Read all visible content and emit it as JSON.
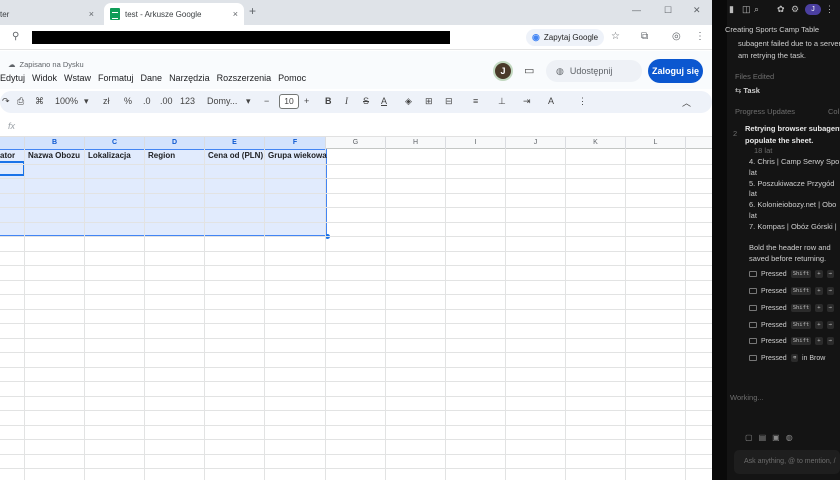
{
  "browser": {
    "tabs": [
      {
        "title": "ter",
        "close": "×"
      },
      {
        "title": "test - Arkusze Google",
        "close": "×"
      }
    ],
    "new_tab": "+",
    "window_controls": [
      "—",
      "☐",
      "✕"
    ],
    "ask_google": "Zapytaj Google"
  },
  "sheets": {
    "save_status": "Zapisano na Dysku",
    "menu": [
      "Edytuj",
      "Widok",
      "Wstaw",
      "Formatuj",
      "Dane",
      "Narzędzia",
      "Rozszerzenia",
      "Pomoc"
    ],
    "avatar_letter": "J",
    "share_label": "Udostępnij",
    "login_label": "Zaloguj się",
    "toolbar": {
      "zoom": "100%",
      "percent": "%",
      "decrease_decimals": ".0",
      "increase_decimals": ".00",
      "number_format": "123",
      "font": "Domy...",
      "font_size": "10",
      "bold": "B",
      "italic": "I",
      "strikethrough": "S",
      "text_color": "A",
      "minus": "−",
      "plus": "+"
    },
    "fx": "fx",
    "columns": [
      {
        "letter": "",
        "header": "ator"
      },
      {
        "letter": "B",
        "header": "Nazwa Obozu"
      },
      {
        "letter": "C",
        "header": "Lokalizacja"
      },
      {
        "letter": "D",
        "header": "Region"
      },
      {
        "letter": "E",
        "header": "Cena od (PLN)"
      },
      {
        "letter": "F",
        "header": "Grupa wiekowa"
      },
      {
        "letter": "G",
        "header": ""
      },
      {
        "letter": "H",
        "header": ""
      },
      {
        "letter": "I",
        "header": ""
      },
      {
        "letter": "J",
        "header": ""
      },
      {
        "letter": "K",
        "header": ""
      },
      {
        "letter": "L",
        "header": ""
      }
    ]
  },
  "agent_panel": {
    "title_line": "Creating Sports Camp Table",
    "subagent_msg_1": "subagent failed due to a server",
    "subagent_msg_2": "am retrying the task.",
    "files_edited_label": "Files Edited",
    "file_task": "Task",
    "progress_label": "Progress Updates",
    "collapse_label": "Col",
    "step_number": "2",
    "step_title_1": "Retrying browser subagent",
    "step_title_2": "populate the sheet.",
    "lines": [
      "18 lat",
      "4. Chris | Camp Serwy Spo",
      "lat",
      "5. Poszukiwacze Przygód",
      "lat",
      "6. Kolonieiobozy.net | Obo",
      "lat",
      "7. Kompas | Obóz Górski |"
    ],
    "instruction_1": "Bold the header row and",
    "instruction_2": "saved before returning.",
    "pressed_rows": [
      {
        "label": "Pressed",
        "keys": [
          "Shift",
          "+",
          "→"
        ]
      },
      {
        "label": "Pressed",
        "keys": [
          "Shift",
          "+",
          "→"
        ]
      },
      {
        "label": "Pressed",
        "keys": [
          "Shift",
          "+",
          "→"
        ]
      },
      {
        "label": "Pressed",
        "keys": [
          "Shift",
          "+",
          "→"
        ]
      },
      {
        "label": "Pressed",
        "keys": [
          "Shift",
          "+",
          "→"
        ]
      },
      {
        "label": "Pressed",
        "keys": [
          "⌫",
          "in Brow"
        ]
      }
    ],
    "working": "Working...",
    "input_placeholder": "Ask anything, @ to mention, /"
  }
}
